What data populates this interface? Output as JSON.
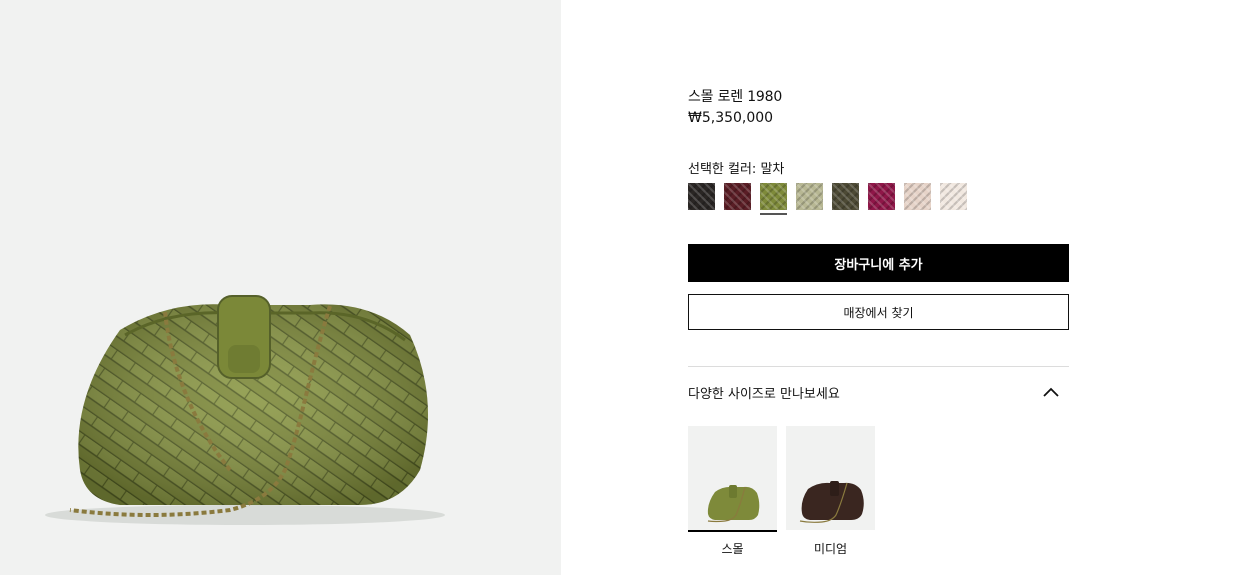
{
  "product": {
    "title": "스몰 로렌 1980",
    "price": "₩5,350,000",
    "image_alt": "green intrecciato clutch with chain strap"
  },
  "color": {
    "label": "선택한 컬러: 말차",
    "selected_index": 2,
    "swatches": [
      {
        "name": "black",
        "color": "#2a2624"
      },
      {
        "name": "burgundy",
        "color": "#5a1d25"
      },
      {
        "name": "matcha",
        "color": "#7e8a3a"
      },
      {
        "name": "sage",
        "color": "#b7b793"
      },
      {
        "name": "olive",
        "color": "#4d4a35"
      },
      {
        "name": "magenta",
        "color": "#8f1648"
      },
      {
        "name": "blush",
        "color": "#e6d3c8"
      },
      {
        "name": "ivory",
        "color": "#f1e8e0"
      }
    ]
  },
  "actions": {
    "add_to_cart": "장바구니에 추가",
    "find_in_store": "매장에서 찾기"
  },
  "sizes": {
    "heading": "다양한 사이즈로 만나보세요",
    "expanded": true,
    "items": [
      {
        "label": "스몰",
        "selected": true,
        "bag_color": "#7e8a3a"
      },
      {
        "label": "미디엄",
        "selected": false,
        "bag_color": "#3a2620"
      }
    ]
  },
  "icons": {
    "accordion": "chevron-up-icon"
  },
  "colors": {
    "hero_bg": "#f1f2f1",
    "bag_green": "#7e8a3a",
    "chain_gold": "#8a7a3e"
  }
}
